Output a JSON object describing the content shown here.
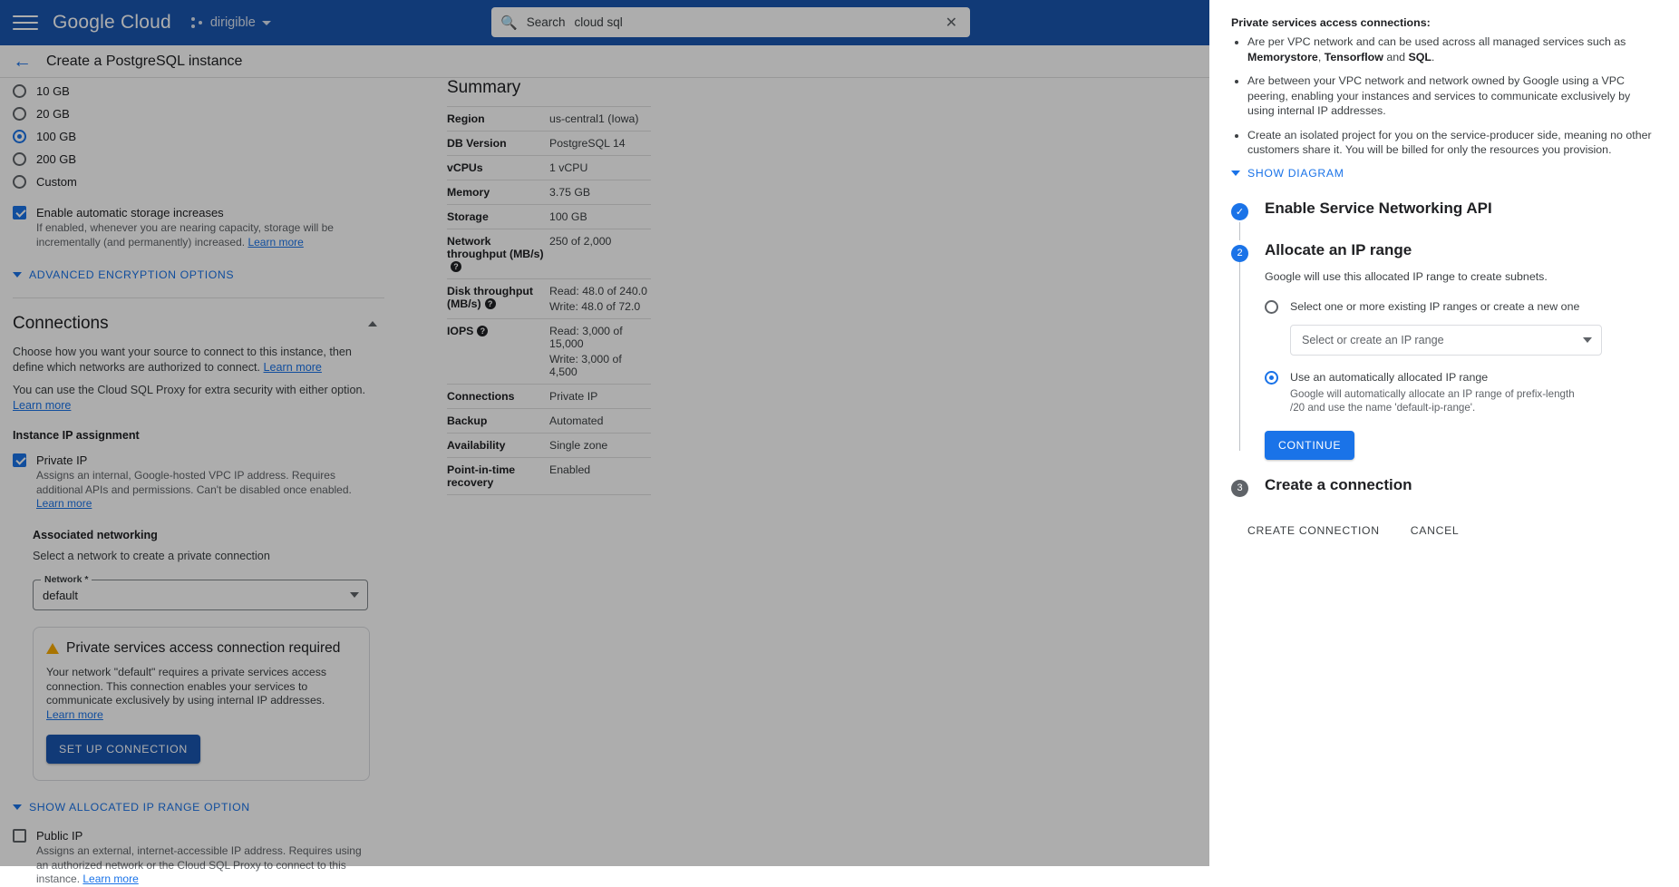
{
  "topbar": {
    "menu_icon": "hamburger-icon",
    "brand_bold": "Google",
    "brand_light": "Cloud",
    "project_name": "dirigible",
    "project_icon": "project-dots-icon",
    "search_icon": "search-icon",
    "search_label": "Search",
    "search_value": "cloud sql",
    "close_icon": "close-icon"
  },
  "page": {
    "back_icon": "back-arrow-icon",
    "title": "Create a PostgreSQL instance"
  },
  "storage": {
    "options": [
      {
        "label": "10 GB",
        "selected": false
      },
      {
        "label": "20 GB",
        "selected": false
      },
      {
        "label": "100 GB",
        "selected": true
      },
      {
        "label": "200 GB",
        "selected": false
      },
      {
        "label": "Custom",
        "selected": false
      }
    ],
    "auto_increase": {
      "label": "Enable automatic storage increases",
      "checked": true,
      "desc": "If enabled, whenever you are nearing capacity, storage will be incrementally (and permanently) increased.",
      "link": "Learn more"
    },
    "advanced_encryption": "ADVANCED ENCRYPTION OPTIONS"
  },
  "connections": {
    "title": "Connections",
    "collapse_icon": "chevron-up-icon",
    "desc1": "Choose how you want your source to connect to this instance, then define which networks are authorized to connect.",
    "desc1_link": "Learn more",
    "desc2": "You can use the Cloud SQL Proxy for extra security with either option.",
    "desc2_link": "Learn more",
    "ip_assignment_heading": "Instance IP assignment",
    "private_ip": {
      "label": "Private IP",
      "checked": true,
      "desc": "Assigns an internal, Google-hosted VPC IP address. Requires additional APIs and permissions. Can't be disabled once enabled.",
      "link": "Learn more"
    },
    "associated_networking_heading": "Associated networking",
    "associated_networking_desc": "Select a network to create a private connection",
    "network_field": {
      "legend": "Network *",
      "value": "default",
      "dropdown_icon": "chevron-down-icon"
    },
    "warning": {
      "icon": "warning-triangle-icon",
      "title": "Private services access connection required",
      "body": "Your network \"default\" requires a private services access connection. This connection enables your services to communicate exclusively by using internal IP addresses.",
      "link": "Learn more",
      "button": "SET UP CONNECTION"
    },
    "show_allocated_range": "SHOW ALLOCATED IP RANGE OPTION",
    "public_ip": {
      "label": "Public IP",
      "checked": false,
      "desc": "Assigns an external, internet-accessible IP address. Requires using an authorized network or the Cloud SQL Proxy to connect to this instance.",
      "link": "Learn more"
    }
  },
  "summary": {
    "title": "Summary",
    "rows": [
      {
        "key": "Region",
        "help": false,
        "values": [
          "us-central1 (Iowa)"
        ]
      },
      {
        "key": "DB Version",
        "help": false,
        "values": [
          "PostgreSQL 14"
        ]
      },
      {
        "key": "vCPUs",
        "help": false,
        "values": [
          "1 vCPU"
        ]
      },
      {
        "key": "Memory",
        "help": false,
        "values": [
          "3.75 GB"
        ]
      },
      {
        "key": "Storage",
        "help": false,
        "values": [
          "100 GB"
        ]
      },
      {
        "key": "Network throughput (MB/s)",
        "help": true,
        "values": [
          "250 of 2,000"
        ]
      },
      {
        "key": "Disk throughput (MB/s)",
        "help": true,
        "values": [
          "Read: 48.0 of 240.0",
          "Write: 48.0 of 72.0"
        ]
      },
      {
        "key": "IOPS",
        "help": true,
        "values": [
          "Read: 3,000 of 15,000",
          "Write: 3,000 of 4,500"
        ]
      },
      {
        "key": "Connections",
        "help": false,
        "values": [
          "Private IP"
        ]
      },
      {
        "key": "Backup",
        "help": false,
        "values": [
          "Automated"
        ]
      },
      {
        "key": "Availability",
        "help": false,
        "values": [
          "Single zone"
        ]
      },
      {
        "key": "Point-in-time recovery",
        "help": false,
        "values": [
          "Enabled"
        ]
      }
    ]
  },
  "drawer": {
    "intro_title": "Private services access connections:",
    "bullets": [
      {
        "pre": "Are per VPC network and can be used across all managed services such as ",
        "bold1": "Memorystore",
        "mid1": ", ",
        "bold2": "Tensorflow",
        "mid2": " and ",
        "bold3": "SQL",
        "post": "."
      },
      {
        "text": "Are between your VPC network and network owned by Google using a VPC peering, enabling your instances and services to communicate exclusively by using internal IP addresses."
      },
      {
        "text": "Create an isolated project for you on the service-producer side, meaning no other customers share it. You will be billed for only the resources you provision."
      }
    ],
    "show_diagram": "SHOW DIAGRAM",
    "show_diagram_icon": "chevron-down-icon",
    "steps": [
      {
        "marker": "check",
        "marker_icon": "check-circle-icon",
        "title": "Enable Service Networking API"
      },
      {
        "marker": "2",
        "title": "Allocate an IP range"
      },
      {
        "marker": "3",
        "title": "Create a connection"
      }
    ],
    "step2": {
      "desc": "Google will use this allocated IP range to create subnets.",
      "option_existing": {
        "label": "Select one or more existing IP ranges or create a new one",
        "selected": false
      },
      "ip_range_select": {
        "placeholder": "Select or create an IP range",
        "dropdown_icon": "chevron-down-icon"
      },
      "option_auto": {
        "label": "Use an automatically allocated IP range",
        "selected": true,
        "desc": "Google will automatically allocate an IP range of prefix-length /20 and use the name 'default-ip-range'."
      },
      "continue_button": "CONTINUE"
    },
    "footer": {
      "create_connection": "CREATE CONNECTION",
      "cancel": "CANCEL"
    }
  }
}
